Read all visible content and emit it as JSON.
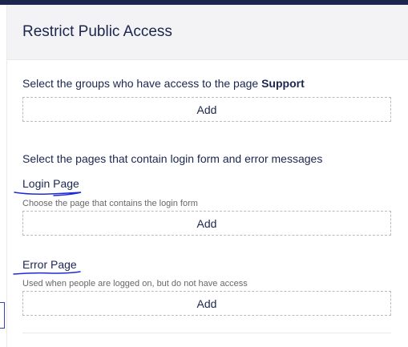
{
  "dialog": {
    "title": "Restrict Public Access"
  },
  "groups": {
    "prompt_prefix": "Select the groups who have access to the page ",
    "page_name": "Support",
    "add_label": "Add"
  },
  "pages": {
    "prompt": "Select the pages that contain login form and error messages",
    "login": {
      "label": "Login Page",
      "description": "Choose the page that contains the login form",
      "add_label": "Add"
    },
    "error": {
      "label": "Error Page",
      "description": "Used when people are logged on, but do not have access",
      "add_label": "Add"
    }
  },
  "colors": {
    "text": "#1b264f",
    "muted": "#68676b",
    "annotation": "#1f2ad6",
    "dashed_border": "#bbbbbb"
  }
}
